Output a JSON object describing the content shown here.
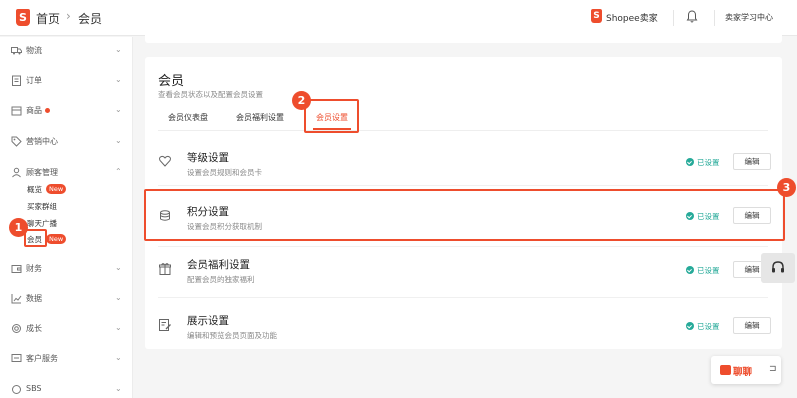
{
  "header": {
    "logo": "S",
    "home": "首页",
    "separator": "›",
    "current": "会员",
    "shop_logo": "S",
    "shop": "Shopee卖家",
    "bell_icon": "bell-icon",
    "learning": "卖家学习中心"
  },
  "sidebar": {
    "items": [
      {
        "label": "物流",
        "icon": "truck-icon"
      },
      {
        "label": "订单",
        "icon": "clipboard-icon"
      },
      {
        "label": "商品",
        "icon": "box-icon"
      },
      {
        "label": "营销中心",
        "icon": "tag-icon"
      },
      {
        "label": "顾客管理",
        "icon": "customers-icon"
      },
      {
        "label": "财务",
        "icon": "wallet-icon"
      },
      {
        "label": "数据",
        "icon": "chart-icon"
      },
      {
        "label": "成长",
        "icon": "badge-icon"
      },
      {
        "label": "客户服务",
        "icon": "service-icon"
      },
      {
        "label": "SBS",
        "icon": "sbs-icon"
      }
    ],
    "sub_items": [
      {
        "label": "概览",
        "badge": "New"
      },
      {
        "label": "买家群组"
      },
      {
        "label": "聊天广播"
      },
      {
        "label": "会员",
        "badge": "New"
      }
    ]
  },
  "card": {
    "title": "会员",
    "description": "查看会员状态以及配置会员设置",
    "tabs": [
      {
        "label": "会员仪表盘"
      },
      {
        "label": "会员福利设置"
      },
      {
        "label": "会员设置",
        "active": true
      }
    ]
  },
  "rows": [
    {
      "title": "等级设置",
      "desc": "设置会员规则和会员卡",
      "status": "已设置",
      "button": "编辑",
      "icon": "heart-icon"
    },
    {
      "title": "积分设置",
      "desc": "设置会员积分获取机制",
      "status": "已设置",
      "button": "编辑",
      "icon": "coins-icon"
    },
    {
      "title": "会员福利设置",
      "desc": "配置会员的独家福利",
      "status": "已设置",
      "button": "编辑",
      "icon": "gift-icon"
    },
    {
      "title": "展示设置",
      "desc": "编辑和预览会员页面及功能",
      "status": "已设置",
      "button": "编辑",
      "icon": "edit-icon"
    }
  ],
  "steps": [
    "1",
    "2",
    "3"
  ],
  "chat": {
    "label": "聊聊",
    "icon": "chat-icon",
    "minimize_icon": "minimize-icon"
  },
  "support_icon": "headset-icon",
  "colors": {
    "accent": "#ee4d2d",
    "success": "#26aa99"
  }
}
